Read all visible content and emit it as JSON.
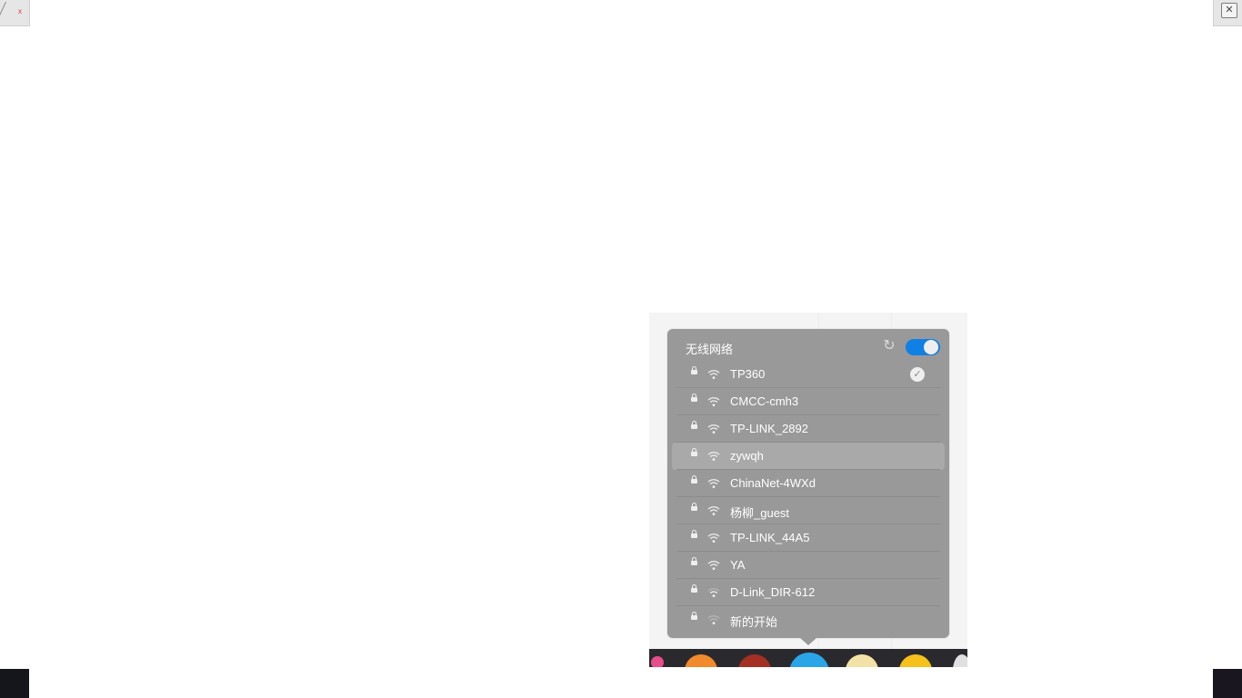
{
  "window": {
    "close_glyph": "✕",
    "close_icon": "close-icon"
  },
  "wifi_panel": {
    "title": "无线网络",
    "refresh_glyph": "↻",
    "enabled": true,
    "connected_glyph": "✓",
    "networks": [
      {
        "ssid": "TP360",
        "secured": true,
        "signal": "strong",
        "connected": true
      },
      {
        "ssid": "CMCC-cmh3",
        "secured": true,
        "signal": "strong"
      },
      {
        "ssid": "TP-LINK_2892",
        "secured": true,
        "signal": "strong"
      },
      {
        "ssid": "zywqh",
        "secured": true,
        "signal": "strong",
        "hovered": true
      },
      {
        "ssid": "ChinaNet-4WXd",
        "secured": true,
        "signal": "strong"
      },
      {
        "ssid": "杨柳_guest",
        "secured": true,
        "signal": "strong"
      },
      {
        "ssid": "TP-LINK_44A5",
        "secured": true,
        "signal": "strong"
      },
      {
        "ssid": "YA",
        "secured": true,
        "signal": "strong"
      },
      {
        "ssid": "D-Link_DIR-612",
        "secured": true,
        "signal": "medium"
      },
      {
        "ssid": "新的开始",
        "secured": true,
        "signal": "weak"
      }
    ]
  },
  "dock": {
    "apps": [
      "launcher-icon",
      "store-icon",
      "music-icon",
      "browser-icon",
      "file-manager-icon",
      "settings-icon",
      "trash-icon"
    ]
  }
}
